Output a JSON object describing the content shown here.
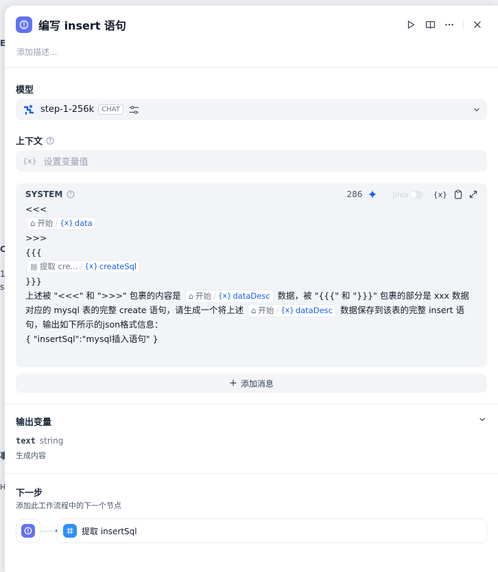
{
  "background_fragments": [
    "E",
    "C",
    "1",
    "s",
    "事",
    "H"
  ],
  "header": {
    "title": "编写 insert 语句",
    "description_placeholder": "添加描述..."
  },
  "model": {
    "label": "模型",
    "name": "step-1-256k",
    "mode_badge": "CHAT"
  },
  "context": {
    "label": "上下文",
    "placeholder": "设置变量值"
  },
  "system": {
    "title": "SYSTEM",
    "token_count": "286",
    "jinja_label": "Jinja",
    "lines": {
      "l1": "<<<",
      "l3": ">>>",
      "l4": "{{{",
      "l6": "}}}",
      "p1a": "上述被 \"<<<\" 和 \">>>\" 包裹的内容是",
      "p1b": "数据，被 \"{{{\" 和 \"}}}\" 包裹的部分是 xxx 数据对应的 mysql 表的完整 create 语句，请生成一个将上述",
      "p1c": "数据保存到该表的完整 insert 语句，输出如下所示的json格式信息：",
      "last": "{ \"insertSql\":\"mysql插入语句\" }"
    },
    "chips": {
      "start": "开始",
      "data": "data",
      "extract": "提取 cre...",
      "createSql": "createSql",
      "dataDesc": "dataDesc"
    }
  },
  "add_message": "添加消息",
  "output": {
    "label": "输出变量",
    "var_name": "text",
    "var_type": "string",
    "var_desc": "生成内容"
  },
  "next": {
    "label": "下一步",
    "description": "添加此工作流程中的下一个节点",
    "target": "提取 insertSql"
  },
  "colors": {
    "accent": "#155eef",
    "node_icon": "#6172f3",
    "extract_icon": "#2e90fa",
    "sparkle": "#155eef"
  }
}
